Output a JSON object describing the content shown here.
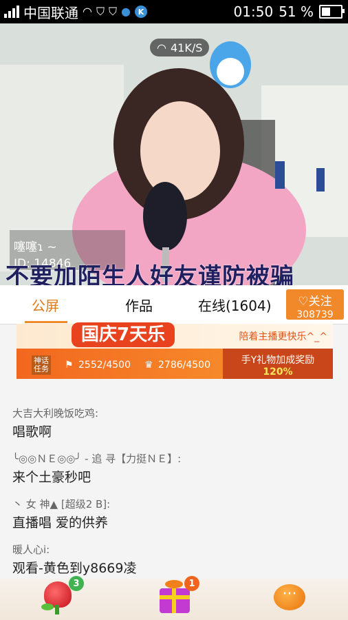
{
  "status_bar": {
    "carrier": "中国联通",
    "network_speed": "41K/S",
    "time": "01:50",
    "battery_percent": "51 %",
    "battery_level": 0.51
  },
  "stream": {
    "host_name": "噻噻ɿ ~",
    "host_id": "ID: 14846",
    "warning_text": "不要加陌生人好友谨防被骗"
  },
  "tabs": [
    {
      "label": "公屏"
    },
    {
      "label": "作品"
    },
    {
      "label": "在线(1604)"
    }
  ],
  "follow_button": {
    "label": "♡关注",
    "count": "308739"
  },
  "banner": {
    "title": "国庆7天乐",
    "promo": "陪着主播更快乐^_^",
    "task_label": "神话任务",
    "stat_1": "2552/4500",
    "stat_2": "2786/4500",
    "bonus_label": "手Y礼物加成奖励",
    "bonus_value": "120%"
  },
  "chat": {
    "messages": [
      {
        "user": "大吉大利晚饭吃鸡:",
        "text": "唱歌啊"
      },
      {
        "user": "╰◎◎ＮＥ◎◎╯ - 追  寻【力挺ＮＥ】:",
        "text": "来个土豪秒吧"
      },
      {
        "user": "丶 女  神▲ [超级2 B]:",
        "text": "直播唱  爱的供养"
      },
      {
        "user": "暖人心i:",
        "text": "观看-黄色到y8669凌"
      }
    ]
  },
  "bottom_bar": {
    "rose_badge": "3",
    "gift_badge": "1",
    "chat_icon_glyph": "···"
  },
  "colors": {
    "accent": "#f1882a",
    "status_bar_bg": "#000000",
    "warning_text": "#202060"
  },
  "icons": [
    "signal-icon",
    "wifi-icon",
    "shield-icon",
    "penguin-icon",
    "k-app-icon",
    "battery-icon",
    "rose-icon",
    "gift-icon",
    "chat-icon"
  ]
}
